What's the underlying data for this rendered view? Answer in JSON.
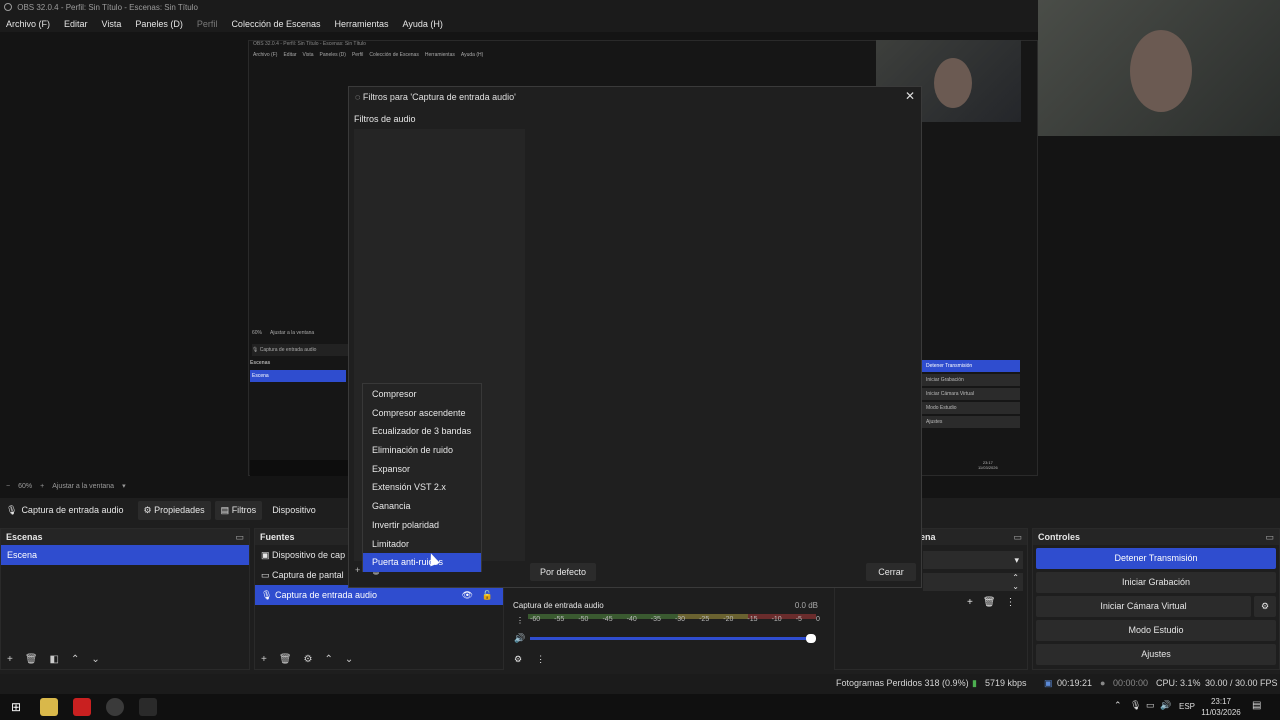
{
  "window": {
    "title": "OBS 32.0.4 - Perfil: Sin Título - Escenas: Sin Título"
  },
  "menu": [
    {
      "label": "Archivo (F)",
      "dim": false
    },
    {
      "label": "Editar",
      "dim": false
    },
    {
      "label": "Vista",
      "dim": false
    },
    {
      "label": "Paneles (D)",
      "dim": false
    },
    {
      "label": "Perfil",
      "dim": true
    },
    {
      "label": "Colección de Escenas",
      "dim": false
    },
    {
      "label": "Herramientas",
      "dim": false
    },
    {
      "label": "Ayuda (H)",
      "dim": false
    }
  ],
  "nested_preview": {
    "title": "OBS 32.0.4 - Perfil: Sin Título - Escenas: Sin Título",
    "menu": [
      "Archivo (F)",
      "Editar",
      "Vista",
      "Paneles (D)",
      "Perfil",
      "Colección de Escenas",
      "Herramientas",
      "Ayuda (H)"
    ],
    "zoom": "60%",
    "fit_label": "Ajustar a la ventana",
    "source_label": "Captura de entrada audio",
    "scenes_title": "Escenas",
    "scene": "Escena",
    "controls": [
      "Detener Transmisión",
      "Iniciar Grabación",
      "Iniciar Cámara Virtual",
      "Modo Estudio",
      "Ajustes"
    ],
    "clock_time": "23:17",
    "clock_date": "11/03/2026"
  },
  "zoombar": {
    "zoom": "60%",
    "fit_label": "Ajustar a la ventana"
  },
  "props_bar": {
    "source": "Captura de entrada audio",
    "properties": "Propiedades",
    "filters": "Filtros",
    "device": "Dispositivo"
  },
  "scenes": {
    "title": "Escenas",
    "items": [
      "Escena"
    ]
  },
  "sources": {
    "title": "Fuentes",
    "items": [
      "Dispositivo de cap",
      "Captura de pantal",
      "Captura de entrada audio"
    ]
  },
  "mixer": {
    "source": "Captura de entrada audio",
    "level": "0.0 dB",
    "ticks": [
      "-60",
      "-55",
      "-50",
      "-45",
      "-40",
      "-35",
      "-30",
      "-25",
      "-20",
      "-15",
      "-10",
      "-5",
      "0"
    ],
    "volume": 1.0
  },
  "transitions": {
    "title": "ena"
  },
  "controls": {
    "title": "Controles",
    "buttons": [
      "Detener Transmisión",
      "Iniciar Grabación",
      "Iniciar Cámara Virtual",
      "Modo Estudio",
      "Ajustes"
    ]
  },
  "status": {
    "dropped": "Fotogramas Perdidos 318 (0.9%)",
    "bitrate": "5719 kbps",
    "stream_time": "00:19:21",
    "rec_time": "00:00:00",
    "cpu": "CPU: 3.1%",
    "fps": "30.00 / 30.00 FPS"
  },
  "taskbar": {
    "lang": "ESP",
    "time": "23:17",
    "date": "11/03/2026"
  },
  "dialog": {
    "title": "Filtros para 'Captura de entrada audio'",
    "filters_label": "Filtros de audio",
    "default_button": "Por defecto",
    "close_button": "Cerrar"
  },
  "context_menu": {
    "items": [
      "Compresor",
      "Compresor ascendente",
      "Ecualizador de 3 bandas",
      "Eliminación de ruido",
      "Expansor",
      "Extensión VST 2.x",
      "Ganancia",
      "Invertir polaridad",
      "Limitador",
      "Puerta anti-ruidos"
    ],
    "highlighted_index": 9
  },
  "colors": {
    "accent": "#2f4dcf",
    "background": "#1e1e1e"
  }
}
